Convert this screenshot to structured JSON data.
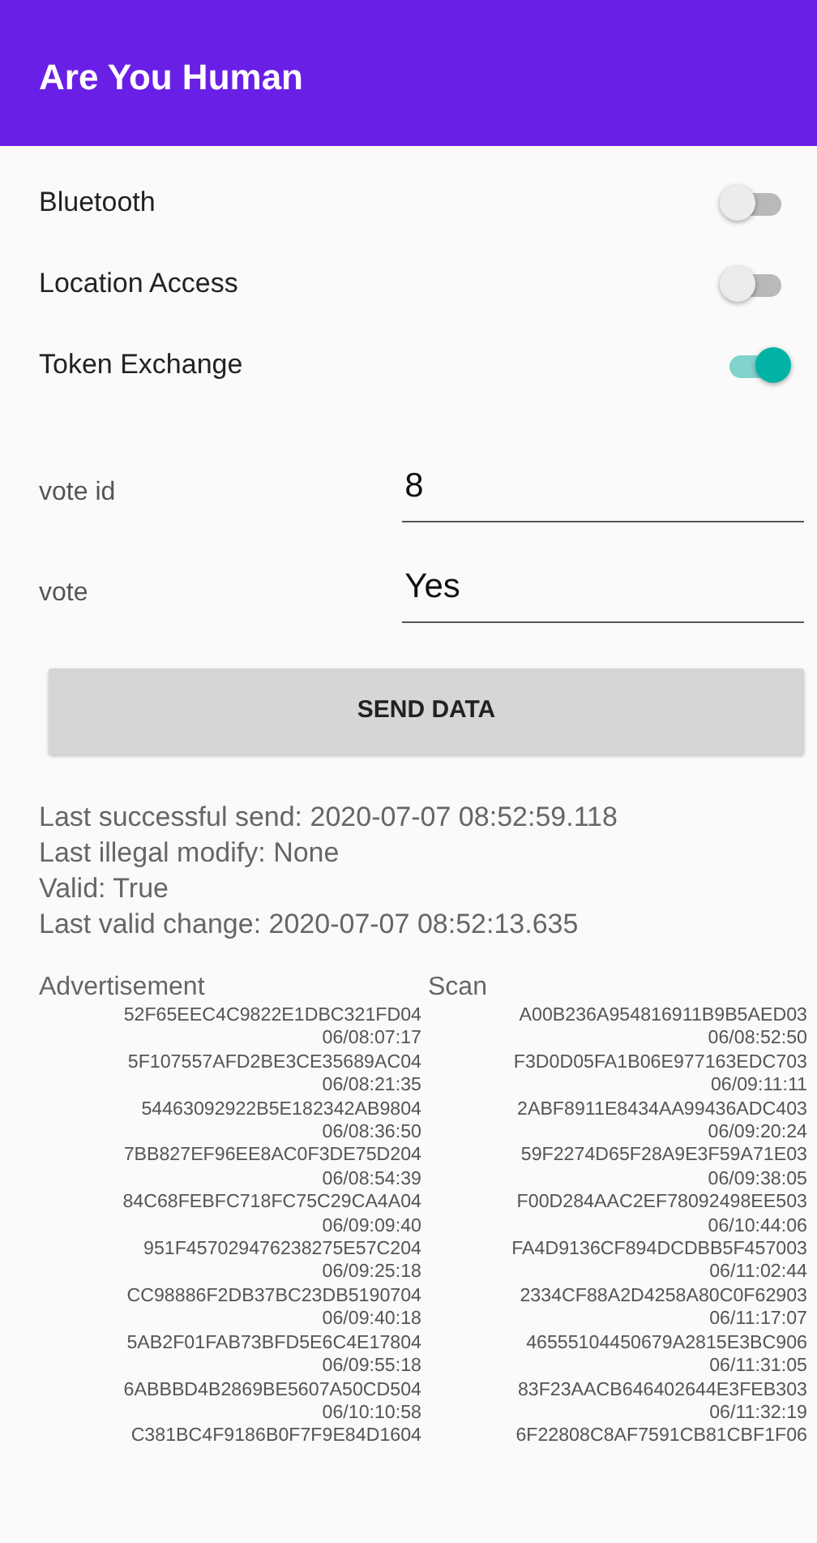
{
  "app_bar": {
    "title": "Are You Human"
  },
  "switches": [
    {
      "label": "Bluetooth",
      "on": false
    },
    {
      "label": "Location Access",
      "on": false
    },
    {
      "label": "Token Exchange",
      "on": true
    }
  ],
  "fields": [
    {
      "label": "vote id",
      "value": "8"
    },
    {
      "label": "vote",
      "value": "Yes"
    }
  ],
  "button": "SEND DATA",
  "status_lines": [
    "Last successful send:  2020-07-07 08:52:59.118",
    "Last illegal modify:  None",
    "Valid:  True",
    "Last valid change:  2020-07-07 08:52:13.635"
  ],
  "lists": [
    {
      "heading": "Advertisement",
      "entries": [
        {
          "id": "52F65EEC4C9822E1DBC321FD04",
          "time": "06/08:07:17"
        },
        {
          "id": "5F107557AFD2BE3CE35689AC04",
          "time": "06/08:21:35"
        },
        {
          "id": "54463092922B5E182342AB9804",
          "time": "06/08:36:50"
        },
        {
          "id": "7BB827EF96EE8AC0F3DE75D204",
          "time": "06/08:54:39"
        },
        {
          "id": "84C68FEBFC718FC75C29CA4A04",
          "time": "06/09:09:40"
        },
        {
          "id": "951F457029476238275E57C204",
          "time": "06/09:25:18"
        },
        {
          "id": "CC98886F2DB37BC23DB5190704",
          "time": "06/09:40:18"
        },
        {
          "id": "5AB2F01FAB73BFD5E6C4E17804",
          "time": "06/09:55:18"
        },
        {
          "id": "6ABBBD4B2869BE5607A50CD504",
          "time": "06/10:10:58"
        },
        {
          "id": "C381BC4F9186B0F7F9E84D1604"
        }
      ]
    },
    {
      "heading": "Scan",
      "entries": [
        {
          "id": "A00B236A954816911B9B5AED03",
          "time": "06/08:52:50"
        },
        {
          "id": "F3D0D05FA1B06E977163EDC703",
          "time": "06/09:11:11"
        },
        {
          "id": "2ABF8911E8434AA99436ADC403",
          "time": "06/09:20:24"
        },
        {
          "id": "59F2274D65F28A9E3F59A71E03",
          "time": "06/09:38:05"
        },
        {
          "id": "F00D284AAC2EF78092498EE503",
          "time": "06/10:44:06"
        },
        {
          "id": "FA4D9136CF894DCDBB5F457003",
          "time": "06/11:02:44"
        },
        {
          "id": "2334CF88A2D4258A80C0F62903",
          "time": "06/11:17:07"
        },
        {
          "id": "46555104450679A2815E3BC906",
          "time": "06/11:31:05"
        },
        {
          "id": "83F23AACB646402644E3FEB303",
          "time": "06/11:32:19"
        },
        {
          "id": "6F22808C8AF7591CB81CBF1F06"
        }
      ]
    }
  ]
}
